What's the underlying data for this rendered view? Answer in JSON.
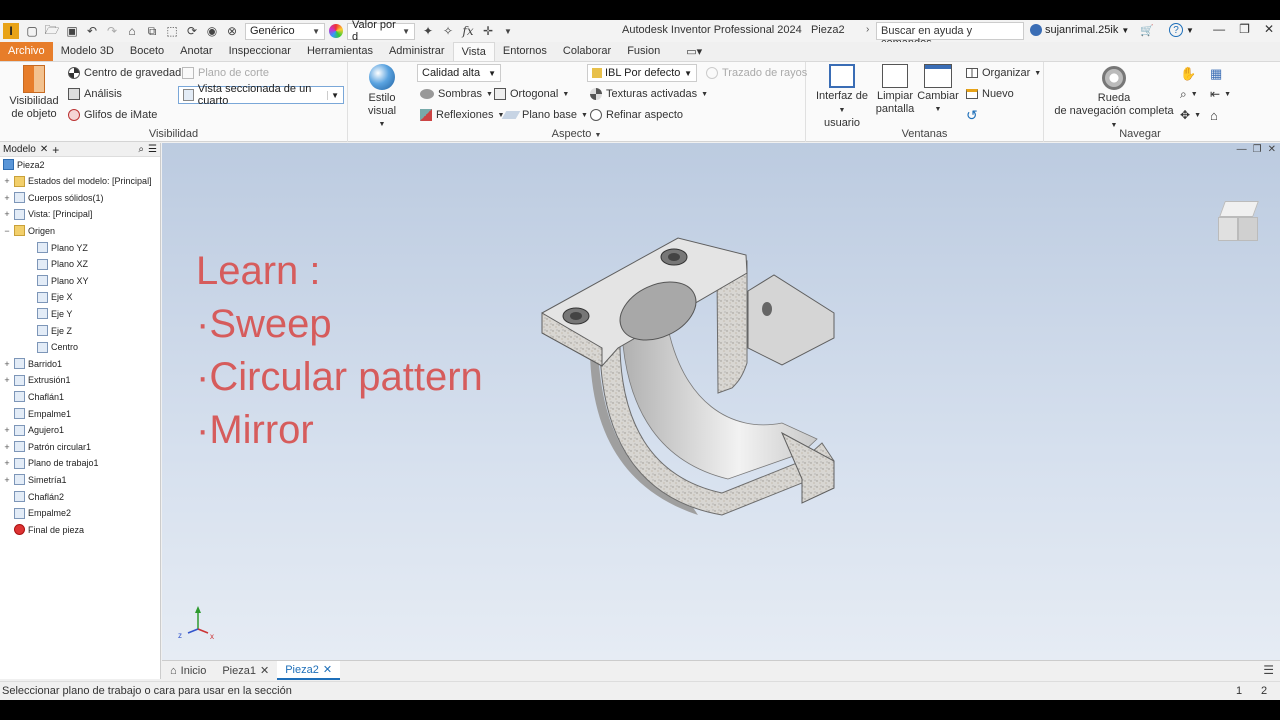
{
  "titlebar": {
    "logo": "I",
    "material": "Genérico",
    "appearance": "Valor por d",
    "app_title": "Autodesk Inventor Professional 2024",
    "doc_title": "Pieza2",
    "search_placeholder": "Buscar en ayuda y comandos...",
    "user": "sujanrimal.25ik"
  },
  "tabs": [
    "Archivo",
    "Modelo 3D",
    "Boceto",
    "Anotar",
    "Inspeccionar",
    "Herramientas",
    "Administrar",
    "Vista",
    "Entornos",
    "Colaborar",
    "Fusion"
  ],
  "active_tab": "Vista",
  "ribbon": {
    "visibilidad": {
      "label": "Visibilidad",
      "obj_vis_1": "Visibilidad",
      "obj_vis_2": "de objeto",
      "centro": "Centro de gravedad",
      "analisis": "Análisis",
      "glifos": "Glifos de iMate",
      "plano_corte": "Plano de corte",
      "vista_seccionada": "Vista seccionada de un cuarto"
    },
    "aspecto": {
      "label": "Aspecto",
      "estilo": "Estilo visual",
      "calidad": "Calidad alta",
      "sombras": "Sombras",
      "reflexiones": "Reflexiones",
      "ortogonal": "Ortogonal",
      "plano_base": "Plano base",
      "ibl": "IBL Por defecto",
      "texturas": "Texturas activadas",
      "refinar": "Refinar aspecto",
      "trazado": "Trazado de rayos"
    },
    "ventanas": {
      "label": "Ventanas",
      "interfaz_1": "Interfaz de",
      "interfaz_2": "usuario",
      "limpiar_1": "Limpiar",
      "limpiar_2": "pantalla",
      "cambiar": "Cambiar",
      "organizar": "Organizar",
      "nuevo": "Nuevo"
    },
    "navegar": {
      "label": "Navegar",
      "rueda_1": "Rueda",
      "rueda_2": "de navegación completa"
    }
  },
  "browser": {
    "title": "Modelo",
    "items": [
      {
        "label": "Pieza2",
        "level": 0,
        "exp": ""
      },
      {
        "label": "Estados del modelo: [Principal]",
        "level": 1,
        "exp": "+"
      },
      {
        "label": "Cuerpos sólidos(1)",
        "level": 1,
        "exp": "+"
      },
      {
        "label": "Vista: [Principal]",
        "level": 1,
        "exp": "+"
      },
      {
        "label": "Origen",
        "level": 1,
        "exp": "−"
      },
      {
        "label": "Plano YZ",
        "level": 2,
        "exp": ""
      },
      {
        "label": "Plano XZ",
        "level": 2,
        "exp": ""
      },
      {
        "label": "Plano XY",
        "level": 2,
        "exp": ""
      },
      {
        "label": "Eje X",
        "level": 2,
        "exp": ""
      },
      {
        "label": "Eje Y",
        "level": 2,
        "exp": ""
      },
      {
        "label": "Eje Z",
        "level": 2,
        "exp": ""
      },
      {
        "label": "Centro",
        "level": 2,
        "exp": ""
      },
      {
        "label": "Barrido1",
        "level": 1,
        "exp": "+"
      },
      {
        "label": "Extrusión1",
        "level": 1,
        "exp": "+"
      },
      {
        "label": "Chaflán1",
        "level": 1,
        "exp": ""
      },
      {
        "label": "Empalme1",
        "level": 1,
        "exp": ""
      },
      {
        "label": "Agujero1",
        "level": 1,
        "exp": "+"
      },
      {
        "label": "Patrón circular1",
        "level": 1,
        "exp": "+"
      },
      {
        "label": "Plano de trabajo1",
        "level": 1,
        "exp": "+"
      },
      {
        "label": "Simetría1",
        "level": 1,
        "exp": "+"
      },
      {
        "label": "Chaflán2",
        "level": 1,
        "exp": ""
      },
      {
        "label": "Empalme2",
        "level": 1,
        "exp": ""
      },
      {
        "label": "Final de pieza",
        "level": 1,
        "exp": ""
      }
    ]
  },
  "viewport": {
    "overlay_lines": [
      "Learn :",
      "·Sweep",
      "·Circular pattern",
      "·Mirror"
    ]
  },
  "doc_tabs": [
    {
      "label": "Inicio",
      "active": false
    },
    {
      "label": "Pieza1",
      "active": false
    },
    {
      "label": "Pieza2",
      "active": true
    }
  ],
  "status": {
    "message": "Seleccionar plano de trabajo o cara para usar en la sección",
    "n1": "1",
    "n2": "2"
  }
}
